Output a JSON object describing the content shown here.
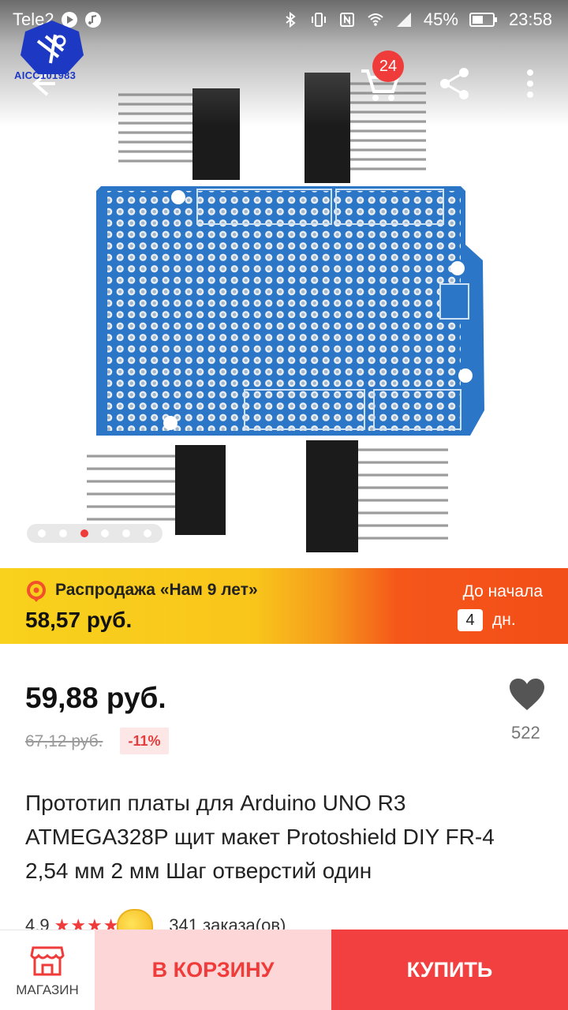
{
  "status_bar": {
    "carrier": "Tele2",
    "battery_percent": "45%",
    "time": "23:58",
    "icons": [
      "bluetooth-icon",
      "vibrate-icon",
      "nfc-icon",
      "wifi-icon",
      "signal-icon",
      "battery-icon"
    ]
  },
  "top_bar": {
    "back_icon": "arrow-left-icon",
    "cart_icon": "cart-icon",
    "cart_badge": "24",
    "share_icon": "share-icon",
    "more_icon": "more-vertical-icon"
  },
  "store_logo": {
    "text": "AICC101983"
  },
  "gallery": {
    "count": 6,
    "active_index": 2
  },
  "promo": {
    "title": "Распродажа «Нам 9 лет»",
    "price": "58,57 руб.",
    "until_label": "До начала",
    "days": "4",
    "days_unit": "дн."
  },
  "product": {
    "price": "59,88 руб.",
    "old_price": "67,12 руб.",
    "discount": "-11%",
    "wishlist_count": "522",
    "title": "Прототип платы для Arduino UNO R3 ATMEGA328P щит макет Protoshield DIY FR-4 2,54 мм 2 мм Шаг отверстий один",
    "rating": "4.9",
    "orders": "341 заказа(ов)"
  },
  "actions": {
    "shop_label": "МАГАЗИН",
    "add_to_cart": "В КОРЗИНУ",
    "buy": "КУПИТЬ"
  },
  "colors": {
    "accent": "#ef3b39",
    "board": "#2b76c6",
    "promo_yellow": "#f8d21c",
    "promo_orange": "#f24e18"
  }
}
